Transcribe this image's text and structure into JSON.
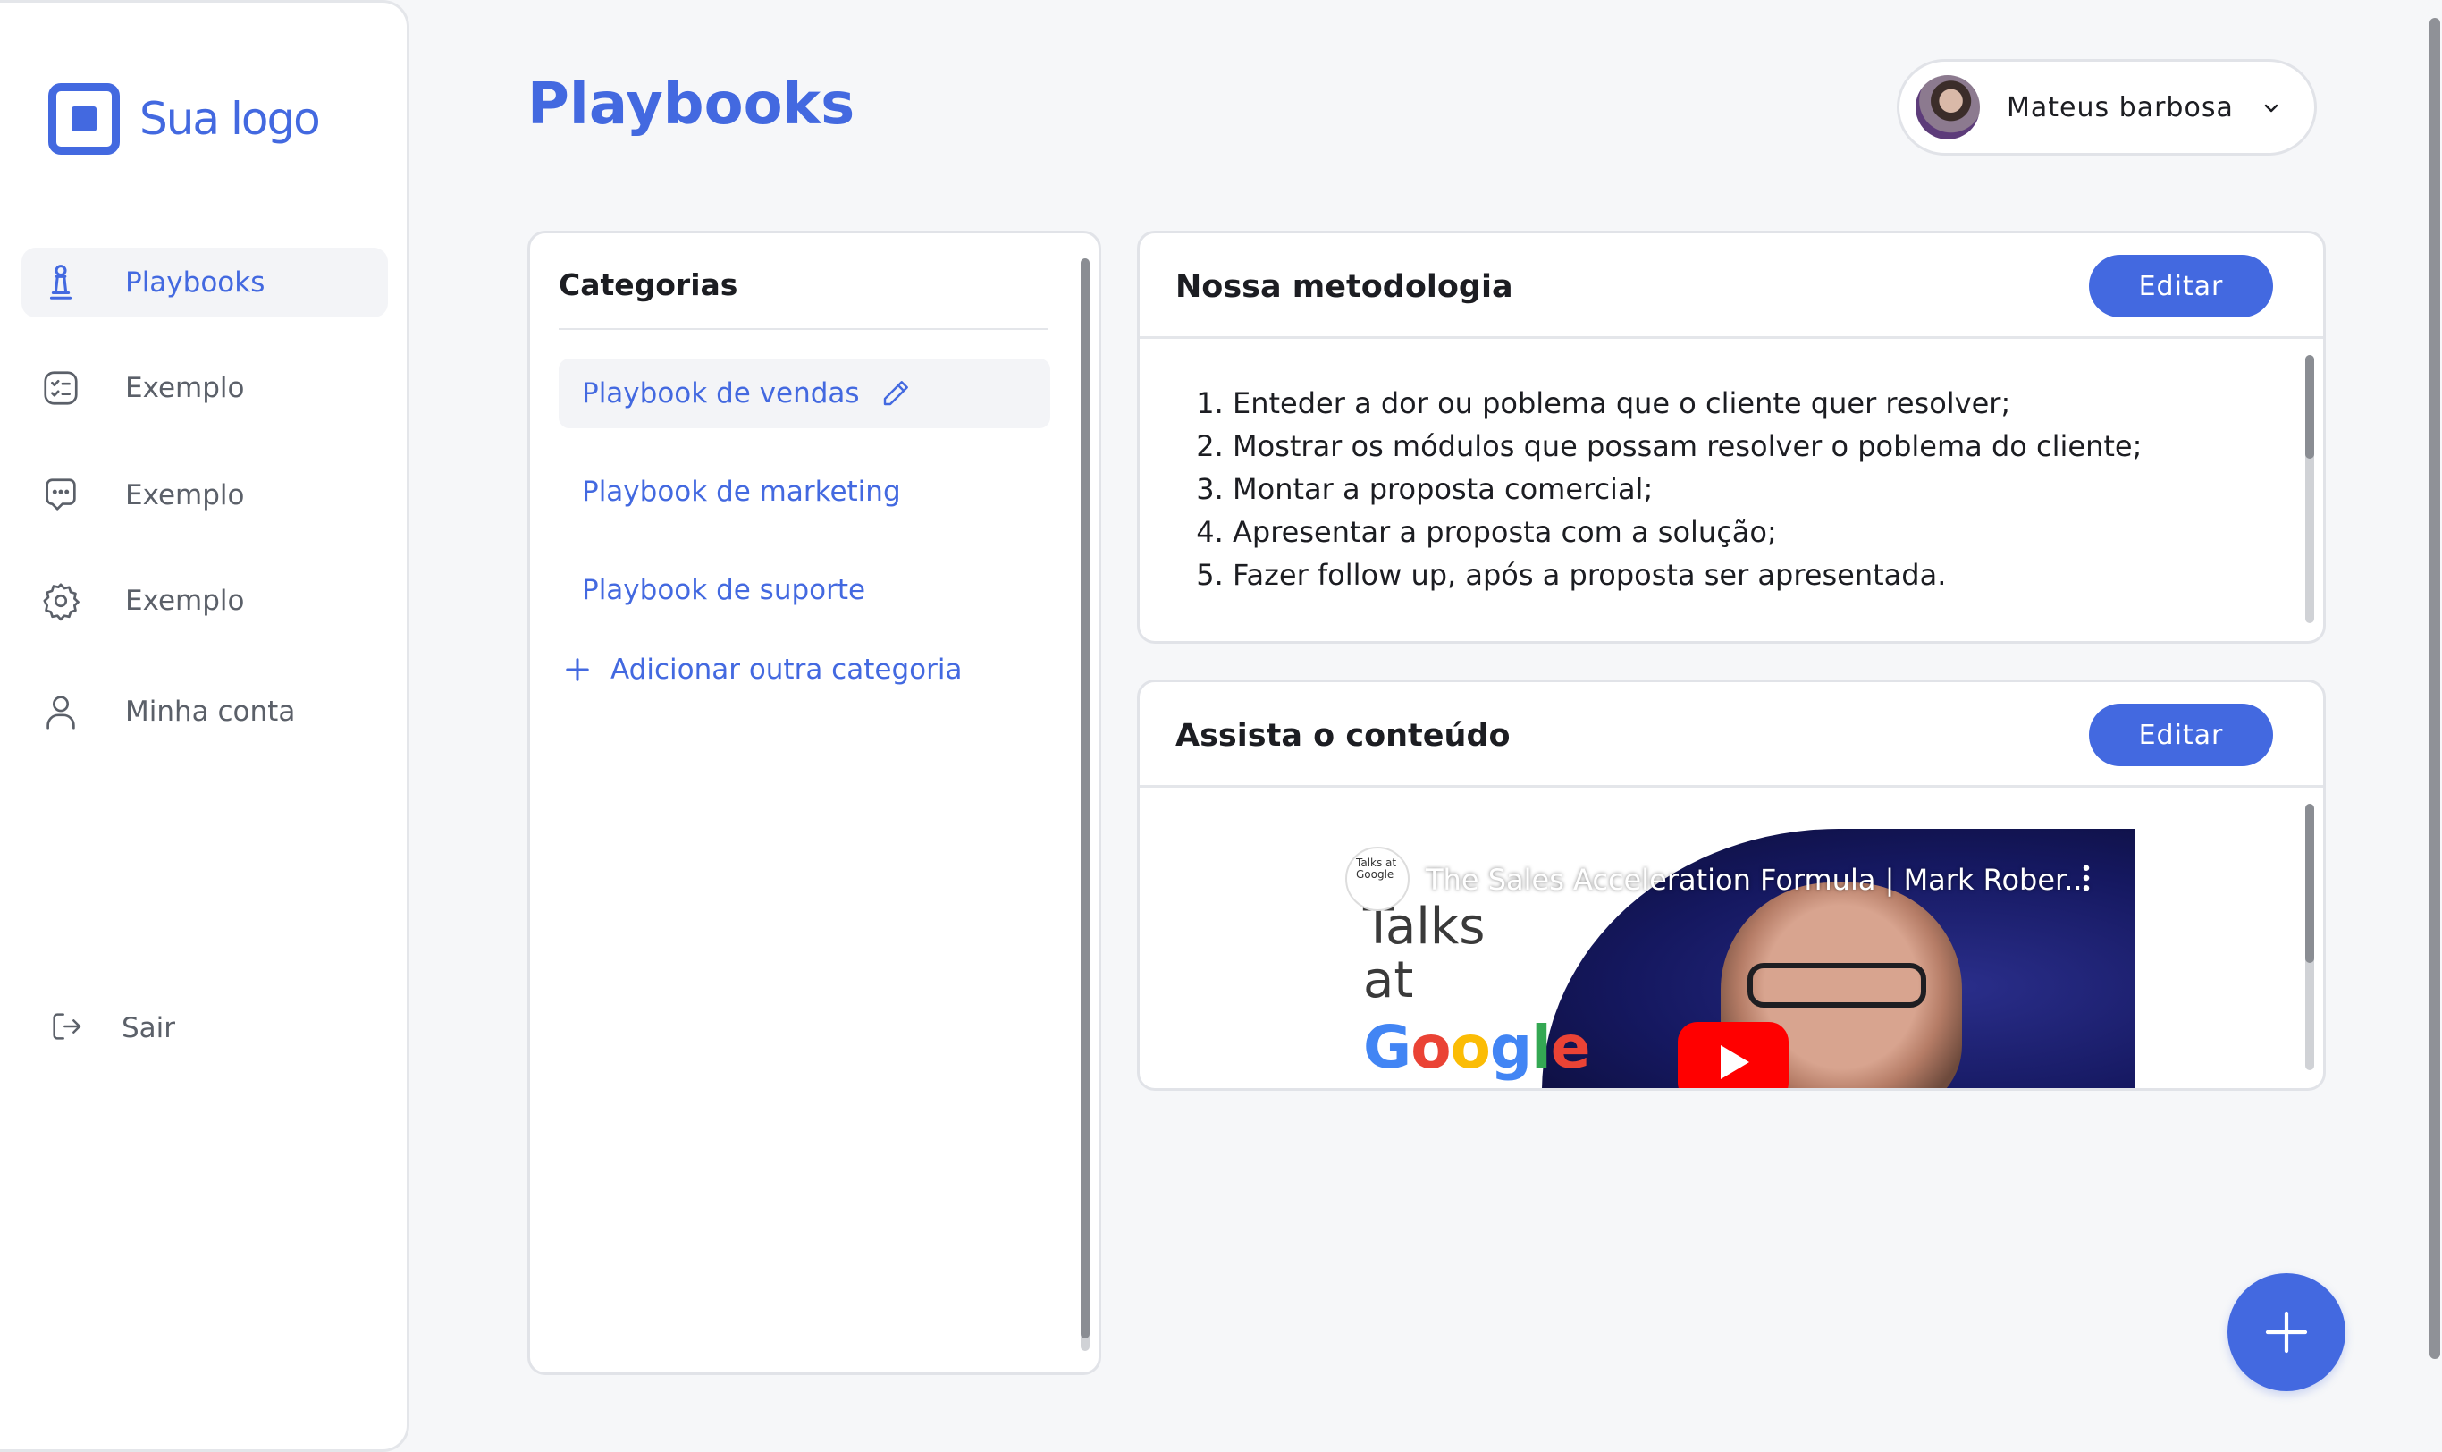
{
  "brand": {
    "logo_text": "Sua logo",
    "accent": "#4369e0"
  },
  "sidebar": {
    "items": [
      {
        "label": "Playbooks",
        "icon": "chess-pawn-icon",
        "active": true
      },
      {
        "label": "Exemplo",
        "icon": "checklist-icon",
        "active": false
      },
      {
        "label": "Exemplo",
        "icon": "chat-bubble-icon",
        "active": false
      },
      {
        "label": "Exemplo",
        "icon": "gear-icon",
        "active": false
      },
      {
        "label": "Minha conta",
        "icon": "user-icon",
        "active": false
      }
    ],
    "logout_label": "Sair"
  },
  "header": {
    "title": "Playbooks",
    "user": {
      "name": "Mateus barbosa"
    }
  },
  "categories": {
    "title": "Categorias",
    "items": [
      {
        "label": "Playbook de vendas",
        "active": true
      },
      {
        "label": "Playbook de marketing",
        "active": false
      },
      {
        "label": "Playbook de suporte",
        "active": false
      }
    ],
    "add_label": "Adicionar outra categoria"
  },
  "methodology": {
    "title": "Nossa metodologia",
    "edit_label": "Editar",
    "steps": [
      "Enteder a dor ou poblema que o cliente quer resolver;",
      "Mostrar os módulos que possam resolver o poblema do cliente;",
      "Montar a proposta comercial;",
      "Apresentar a proposta com a solução;",
      "Fazer follow up, após a proposta ser apresentada."
    ]
  },
  "content": {
    "title": "Assista o conteúdo",
    "edit_label": "Editar",
    "video": {
      "title": "The Sales Acceleration Formula | Mark Rober...",
      "channel_badge": "Talks at Google",
      "thumb_talks": "Talks",
      "thumb_at": "at"
    }
  }
}
